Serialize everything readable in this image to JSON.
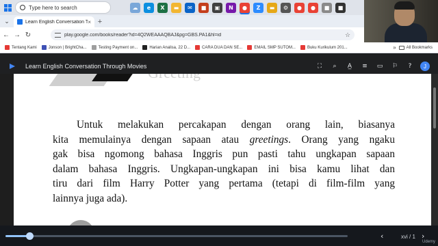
{
  "taskbar": {
    "search_placeholder": "Type here to search",
    "apps": [
      {
        "icon": "widget-icon",
        "color": "#7aa7d9"
      },
      {
        "icon": "edge-icon",
        "color": "#0c8fe0"
      },
      {
        "icon": "excel-icon",
        "color": "#1d7044"
      },
      {
        "icon": "file-explorer-icon",
        "color": "#f2b632"
      },
      {
        "icon": "mail-icon",
        "color": "#0a64c8"
      },
      {
        "icon": "app-icon",
        "color": "#c43e1c"
      },
      {
        "icon": "media-icon",
        "color": "#404040"
      },
      {
        "icon": "onenote-icon",
        "color": "#7719aa"
      },
      {
        "icon": "chrome-icon",
        "color": "#e94235"
      },
      {
        "icon": "zoom-icon",
        "color": "#2d8cff"
      },
      {
        "icon": "folder-icon",
        "color": "#e6a817"
      },
      {
        "icon": "settings-icon",
        "color": "#555555"
      },
      {
        "icon": "chrome-icon",
        "color": "#e94235"
      },
      {
        "icon": "chrome-icon",
        "color": "#e94235"
      },
      {
        "icon": "app-icon",
        "color": "#8a8a8a"
      },
      {
        "icon": "app-icon",
        "color": "#333333"
      }
    ]
  },
  "browser": {
    "tab_title": "Learn English Conversation Th",
    "url": "play.google.com/books/reader?id=4Q2WEAAAQBAJ&pg=GBS.PA1&hl=id",
    "bookmarks": [
      {
        "label": "Tentang Kami",
        "color": "#e53935"
      },
      {
        "label": "Jonson | BrightCha...",
        "color": "#3f51b5"
      },
      {
        "label": "Testing Payment on...",
        "color": "#9e9e9e"
      },
      {
        "label": "Harian Analisa, 22 D...",
        "color": "#212121"
      },
      {
        "label": "CARA DUA DAN SE...",
        "color": "#e53935"
      },
      {
        "label": "EMAIL SMP SUTOM...",
        "color": "#e53935"
      },
      {
        "label": "Buku Kurikulum 201...",
        "color": "#e53935"
      }
    ],
    "all_bookmarks": "All Bookmarks"
  },
  "reader": {
    "book_title": "Learn English Conversation Through Movies",
    "account_initial": "J",
    "heading_fragment": "Greeting",
    "paragraph": [
      "Untuk melakukan percakapan dengan orang lain, biasanya",
      "kita memulainya dengan sapaan atau ",
      "greetings",
      ". Orang yang ngaku",
      "gak bisa ngomong bahasa Inggris pun pasti tahu ungkapan sapaan",
      "dalam bahasa Inggris. Ungkapan-ungkapan ini bisa kamu lihat dan",
      "tiru dari film Harry Potter yang pertama (tetapi di film-film yang",
      "lainnya juga ada)."
    ]
  },
  "player": {
    "progress": 0.07,
    "page_indicator": "xvi / 1",
    "watermark": "Udemy"
  }
}
